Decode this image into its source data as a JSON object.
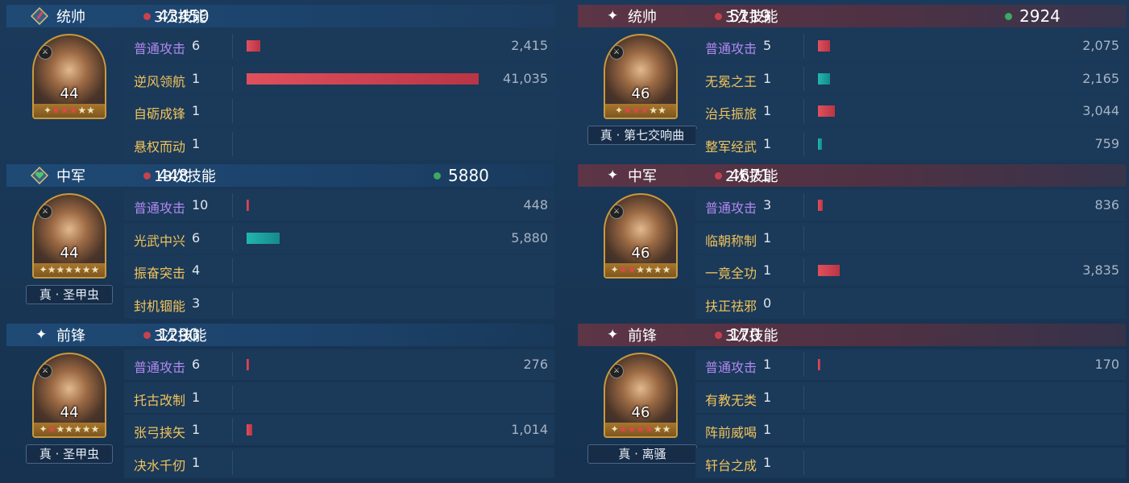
{
  "left": [
    {
      "role": "统帅",
      "skill_count": "3次技能",
      "damage": "43450",
      "heal": null,
      "hero": {
        "level": "44",
        "red_stars": 3,
        "total_stars": 5,
        "tag": null
      },
      "skills": [
        {
          "name": "普通攻击",
          "basic": true,
          "count": "6",
          "value": "2,415",
          "bar": 0.0589,
          "color": "red"
        },
        {
          "name": "逆风领航",
          "basic": false,
          "count": "1",
          "value": "41,035",
          "bar": 1.0,
          "color": "red"
        },
        {
          "name": "自砺成锋",
          "basic": false,
          "count": "1",
          "value": "",
          "bar": 0,
          "color": "red"
        },
        {
          "name": "悬权而动",
          "basic": false,
          "count": "1",
          "value": "",
          "bar": 0,
          "color": "red"
        }
      ]
    },
    {
      "role": "中军",
      "skill_count": "13次技能",
      "damage": "448",
      "heal": "5880",
      "hero": {
        "level": "44",
        "red_stars": 0,
        "total_stars": 6,
        "tag": "真 · 圣甲虫"
      },
      "skills": [
        {
          "name": "普通攻击",
          "basic": true,
          "count": "10",
          "value": "448",
          "bar": 0.0109,
          "color": "red"
        },
        {
          "name": "光武中兴",
          "basic": false,
          "count": "6",
          "value": "5,880",
          "bar": 0.1433,
          "color": "teal"
        },
        {
          "name": "振奋突击",
          "basic": false,
          "count": "4",
          "value": "",
          "bar": 0,
          "color": "red"
        },
        {
          "name": "封机锢能",
          "basic": false,
          "count": "3",
          "value": "",
          "bar": 0,
          "color": "red"
        }
      ]
    },
    {
      "role": "前锋",
      "skill_count": "3次技能",
      "damage": "1290",
      "heal": null,
      "hero": {
        "level": "44",
        "red_stars": 1,
        "total_stars": 6,
        "tag": "真 · 圣甲虫"
      },
      "skills": [
        {
          "name": "普通攻击",
          "basic": true,
          "count": "6",
          "value": "276",
          "bar": 0.0067,
          "color": "red"
        },
        {
          "name": "托古改制",
          "basic": false,
          "count": "1",
          "value": "",
          "bar": 0,
          "color": "red"
        },
        {
          "name": "张弓挟矢",
          "basic": false,
          "count": "1",
          "value": "1,014",
          "bar": 0.0247,
          "color": "red"
        },
        {
          "name": "决水千仞",
          "basic": false,
          "count": "1",
          "value": "",
          "bar": 0,
          "color": "red"
        }
      ]
    }
  ],
  "right": [
    {
      "role": "统帅",
      "skill_count": "3次技能",
      "damage": "5119",
      "heal": "2924",
      "hero": {
        "level": "46",
        "red_stars": 3,
        "total_stars": 5,
        "tag": "真 · 第七交响曲"
      },
      "skills": [
        {
          "name": "普通攻击",
          "basic": true,
          "count": "5",
          "value": "2,075",
          "bar": 0.0506,
          "color": "red"
        },
        {
          "name": "无冕之王",
          "basic": false,
          "count": "1",
          "value": "2,165",
          "bar": 0.0528,
          "color": "teal"
        },
        {
          "name": "治兵振旅",
          "basic": false,
          "count": "1",
          "value": "3,044",
          "bar": 0.0742,
          "color": "red"
        },
        {
          "name": "整军经武",
          "basic": false,
          "count": "1",
          "value": "759",
          "bar": 0.0185,
          "color": "teal"
        }
      ]
    },
    {
      "role": "中军",
      "skill_count": "2次技能",
      "damage": "4671",
      "heal": null,
      "hero": {
        "level": "46",
        "red_stars": 2,
        "total_stars": 6,
        "tag": null
      },
      "skills": [
        {
          "name": "普通攻击",
          "basic": true,
          "count": "3",
          "value": "836",
          "bar": 0.0204,
          "color": "red"
        },
        {
          "name": "临朝称制",
          "basic": false,
          "count": "1",
          "value": "",
          "bar": 0,
          "color": "red"
        },
        {
          "name": "一竟全功",
          "basic": false,
          "count": "1",
          "value": "3,835",
          "bar": 0.0935,
          "color": "red"
        },
        {
          "name": "扶正祛邪",
          "basic": false,
          "count": "0",
          "value": "",
          "bar": 0,
          "color": "red"
        }
      ]
    },
    {
      "role": "前锋",
      "skill_count": "3次技能",
      "damage": "170",
      "heal": null,
      "hero": {
        "level": "46",
        "red_stars": 4,
        "total_stars": 6,
        "tag": "真 · 离骚"
      },
      "skills": [
        {
          "name": "普通攻击",
          "basic": true,
          "count": "1",
          "value": "170",
          "bar": 0.0041,
          "color": "red"
        },
        {
          "name": "有教无类",
          "basic": false,
          "count": "1",
          "value": "",
          "bar": 0,
          "color": "red"
        },
        {
          "name": "阵前威喝",
          "basic": false,
          "count": "1",
          "value": "",
          "bar": 0,
          "color": "red"
        },
        {
          "name": "轩台之成",
          "basic": false,
          "count": "1",
          "value": "",
          "bar": 0,
          "color": "red"
        }
      ]
    }
  ],
  "colors": {
    "damage": "#c8424c",
    "heal": "#3ca862",
    "skill_basic": "#b189f0",
    "skill_other": "#f0c35a"
  },
  "icons": {
    "left_commander": "sword-emblem-icon",
    "left_middle": "heart-emblem-icon",
    "spark": "spark-icon"
  }
}
